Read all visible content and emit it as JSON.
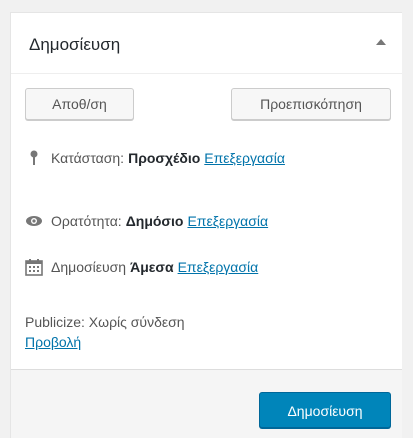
{
  "box": {
    "title": "Δημοσίευση",
    "toggle_icon": "triangle-up-icon"
  },
  "actions": {
    "save_label": "Αποθ/ση",
    "preview_label": "Προεπισκόπηση"
  },
  "status": {
    "icon": "pin-icon",
    "label": "Κατάσταση:",
    "value": "Προσχέδιο",
    "edit_link": "Επεξεργασία"
  },
  "visibility": {
    "icon": "eye-icon",
    "label": "Ορατότητα:",
    "value": "Δημόσιο",
    "edit_link": "Επεξεργασία"
  },
  "schedule": {
    "icon": "calendar-icon",
    "label": "Δημοσίευση",
    "value": "Άμεσα",
    "edit_link": "Επεξεργασία"
  },
  "publicize": {
    "text": "Publicize: Χωρίς σύνδεση",
    "link": "Προβολή"
  },
  "footer": {
    "publish_label": "Δημοσίευση"
  },
  "colors": {
    "primary": "#0085ba",
    "link": "#0073aa"
  }
}
